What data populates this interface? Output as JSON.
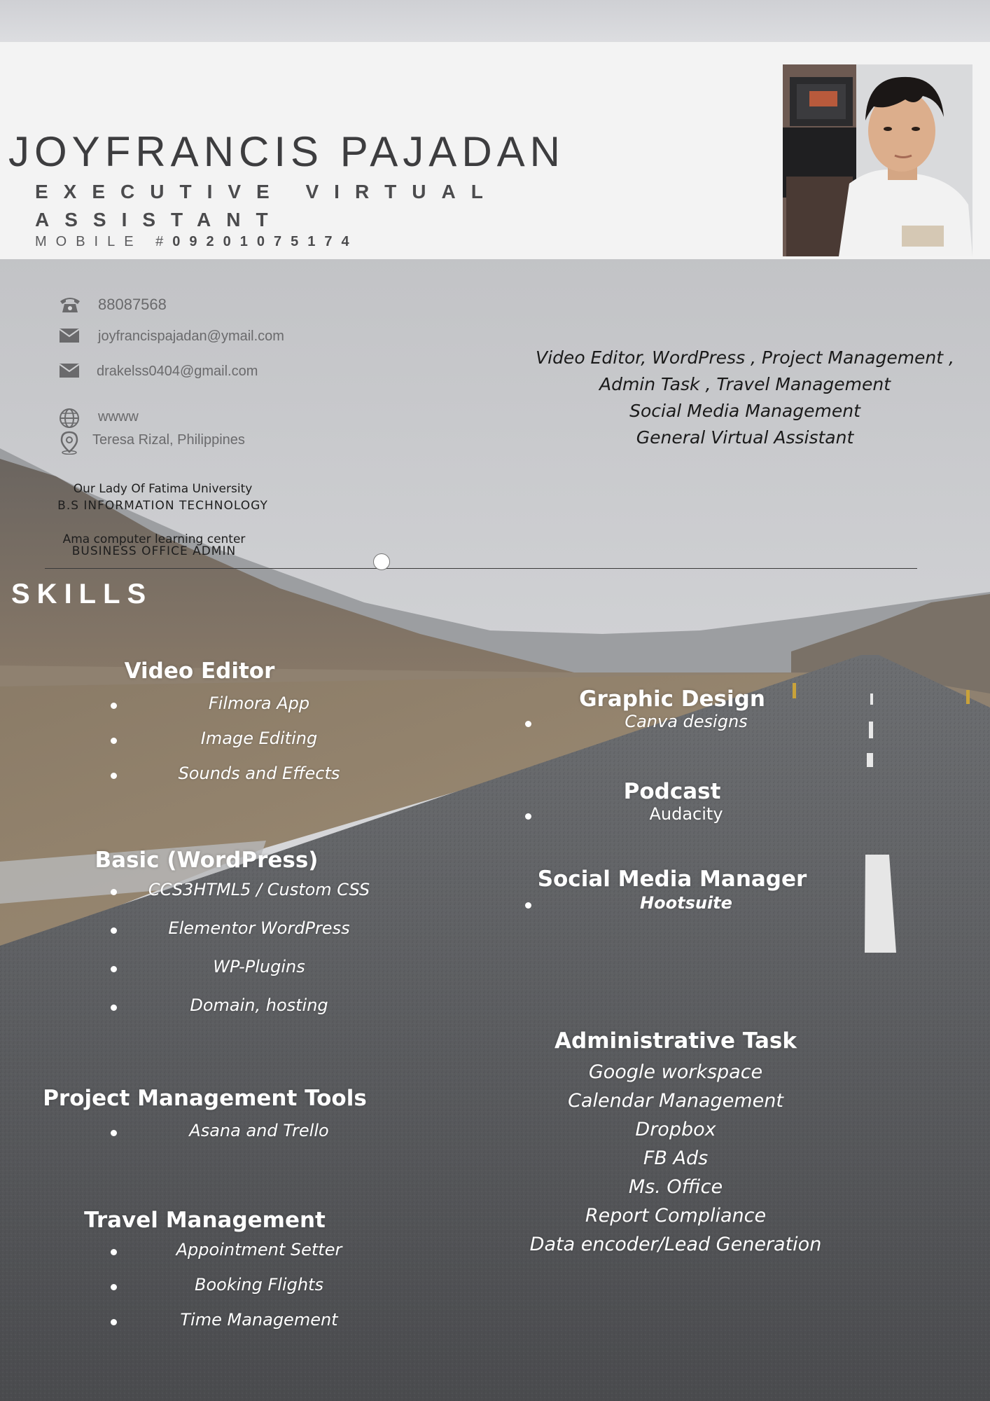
{
  "header": {
    "name": "JOYFRANCIS PAJADAN",
    "job_title": "EXECUTIVE VIRTUAL ASSISTANT",
    "mobile_label": "MOBILE #",
    "mobile_number": "09201075174"
  },
  "contact": {
    "phone": "88087568",
    "email_1": "joyfrancispajadan@ymail.com",
    "email_2": "drakelss0404@gmail.com",
    "website": "wwww",
    "location": "Teresa Rizal, Philippines"
  },
  "tagline": [
    "Video Editor, WordPress , Project Management ,",
    "Admin Task , Travel Management",
    "Social Media Management",
    "General Virtual Assistant"
  ],
  "education": [
    {
      "school": "Our Lady Of Fatima University",
      "degree": "B.S INFORMATION TECHNOLOGY"
    },
    {
      "school": "Ama computer learning center",
      "degree": "BUSINESS OFFICE ADMIN"
    }
  ],
  "skills_title": "SKILLS",
  "skills_left": [
    {
      "title": "Video Editor",
      "items": [
        "Filmora App",
        "Image Editing",
        "Sounds and Effects"
      ]
    },
    {
      "title": "Basic (WordPress)",
      "items": [
        "CCS3HTML5 / Custom CSS",
        "Elementor WordPress",
        "WP-Plugins",
        "Domain, hosting"
      ]
    },
    {
      "title": "Project Management Tools",
      "items": [
        "Asana and Trello"
      ]
    },
    {
      "title": "Travel Management",
      "items": [
        "Appointment Setter",
        "Booking Flights",
        "Time Management"
      ]
    }
  ],
  "skills_right": [
    {
      "title": "Graphic Design",
      "items": [
        "Canva designs"
      ]
    },
    {
      "title": "Podcast",
      "items": [
        "Audacity"
      ]
    },
    {
      "title": "Social Media Manager",
      "items": [
        "Hootsuite"
      ]
    },
    {
      "title": "Administrative Task",
      "items": [
        "Google workspace",
        "Calendar Management",
        "Dropbox",
        "FB Ads",
        "Ms. Office",
        "Report Compliance",
        "Data encoder/Lead Generation"
      ]
    }
  ],
  "colors": {
    "header_bg": "#f3f3f3",
    "name_text": "#3d3d3f",
    "skills_text": "#ffffff",
    "tagline_text": "#1a1a1a"
  },
  "icons": [
    "phone-icon",
    "mail-icon",
    "mail-icon",
    "globe-icon",
    "location-pin-icon",
    "profile-photo"
  ]
}
